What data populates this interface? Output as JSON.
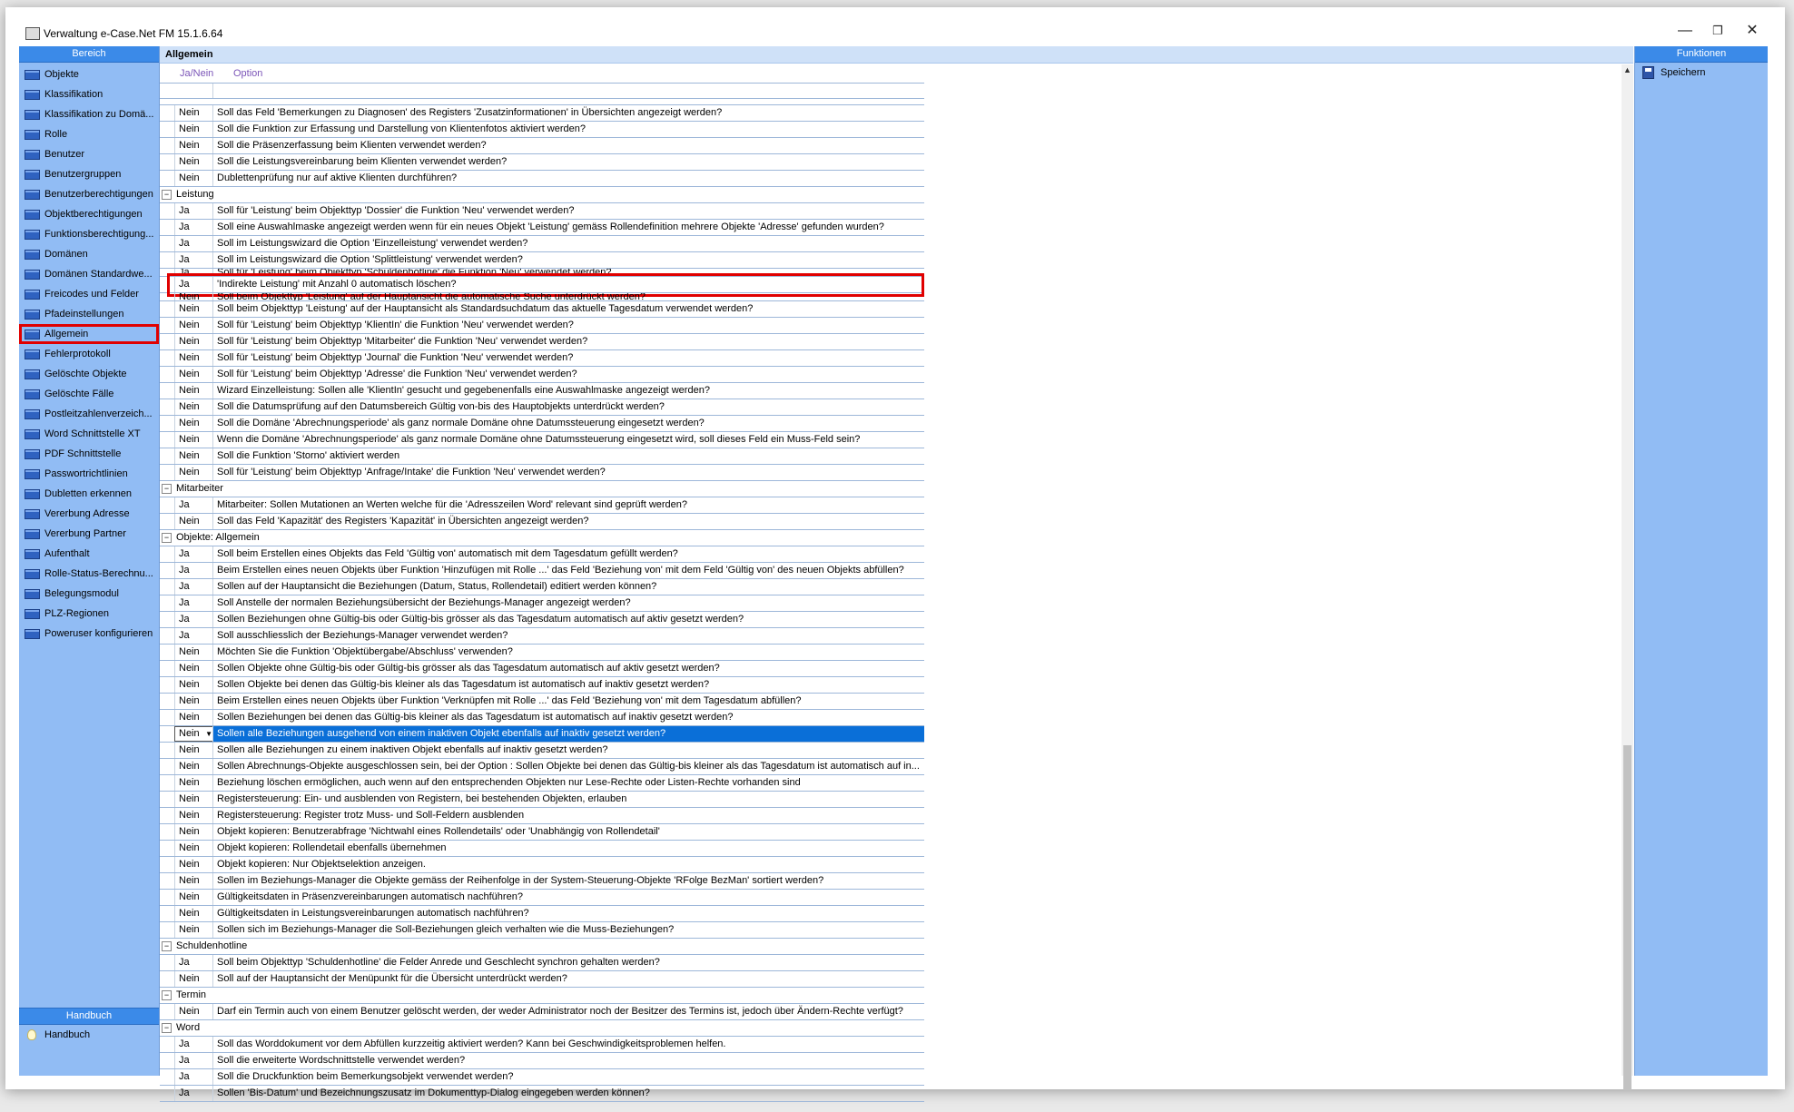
{
  "window": {
    "title": "Verwaltung e-Case.Net FM 15.1.6.64",
    "minimize_glyph": "—",
    "restore_glyph": "❐",
    "close_glyph": "✕"
  },
  "sidebar": {
    "header": "Bereich",
    "items": [
      {
        "label": "Objekte"
      },
      {
        "label": "Klassifikation"
      },
      {
        "label": "Klassifikation zu Domä..."
      },
      {
        "label": "Rolle"
      },
      {
        "label": "Benutzer"
      },
      {
        "label": "Benutzergruppen"
      },
      {
        "label": "Benutzerberechtigungen"
      },
      {
        "label": "Objektberechtigungen"
      },
      {
        "label": "Funktionsberechtigung..."
      },
      {
        "label": "Domänen"
      },
      {
        "label": "Domänen Standardwe..."
      },
      {
        "label": "Freicodes und Felder"
      },
      {
        "label": "Pfadeinstellungen"
      },
      {
        "label": "Allgemein",
        "highlighted": true
      },
      {
        "label": "Fehlerprotokoll"
      },
      {
        "label": "Gelöschte Objekte"
      },
      {
        "label": "Gelöschte Fälle"
      },
      {
        "label": "Postleitzahlenverzeich..."
      },
      {
        "label": "Word Schnittstelle XT"
      },
      {
        "label": "PDF Schnittstelle"
      },
      {
        "label": "Passwortrichtlinien"
      },
      {
        "label": "Dubletten erkennen"
      },
      {
        "label": "Vererbung Adresse"
      },
      {
        "label": "Vererbung Partner"
      },
      {
        "label": "Aufenthalt"
      },
      {
        "label": "Rolle-Status-Berechnu..."
      },
      {
        "label": "Belegungsmodul"
      },
      {
        "label": "PLZ-Regionen"
      },
      {
        "label": "Poweruser konfigurieren"
      }
    ],
    "handbuch_header": "Handbuch",
    "handbuch_item": "Handbuch"
  },
  "main": {
    "header": "Allgemein",
    "col_value": "Ja/Nein",
    "col_option": "Option",
    "rows": [
      {
        "v": "Nein",
        "t": "Soll das Feld 'Bemerkungen zu Diagnosen' des Registers 'Zusatzinformationen' in Übersichten angezeigt werden?"
      },
      {
        "v": "Nein",
        "t": "Soll die Funktion zur Erfassung und Darstellung von Klientenfotos aktiviert werden?"
      },
      {
        "v": "Nein",
        "t": "Soll die Präsenzerfassung beim Klienten verwendet werden?"
      },
      {
        "v": "Nein",
        "t": "Soll die Leistungsvereinbarung beim Klienten verwendet werden?"
      },
      {
        "v": "Nein",
        "t": "Dublettenprüfung nur auf aktive Klienten durchführen?"
      },
      {
        "group": "Leistung",
        "toggle": "−"
      },
      {
        "v": "Ja",
        "t": "Soll für 'Leistung' beim Objekttyp 'Dossier' die Funktion 'Neu' verwendet werden?"
      },
      {
        "v": "Ja",
        "t": "Soll eine Auswahlmaske angezeigt werden wenn für ein neues Objekt 'Leistung' gemäss Rollendefinition mehrere Objekte 'Adresse' gefunden wurden?"
      },
      {
        "v": "Ja",
        "t": "Soll im Leistungswizard die Option 'Einzelleistung' verwendet werden?"
      },
      {
        "v": "Ja",
        "t": "Soll im Leistungswizard die Option 'Splittleistung' verwendet werden?"
      },
      {
        "v": "Ja",
        "t": "Soll für 'Leistung' beim Objekttyp 'Schuldenhotline' die Funktion 'Neu' verwendet werden?",
        "clip": true
      },
      {
        "v": "Ja",
        "t": "'Indirekte Leistung' mit Anzahl 0 automatisch löschen?",
        "boxed": true
      },
      {
        "v": "Nein",
        "t": "Soll beim Objekttyp 'Leistung' auf der Hauptansicht die automatische Suche unterdrückt werden?",
        "clip": true
      },
      {
        "v": "Nein",
        "t": "Soll beim Objekttyp 'Leistung' auf der Hauptansicht als Standardsuchdatum das aktuelle Tagesdatum verwendet werden?"
      },
      {
        "v": "Nein",
        "t": "Soll für 'Leistung' beim Objekttyp 'KlientIn' die Funktion 'Neu' verwendet werden?"
      },
      {
        "v": "Nein",
        "t": "Soll für 'Leistung' beim Objekttyp 'Mitarbeiter' die Funktion 'Neu' verwendet werden?"
      },
      {
        "v": "Nein",
        "t": "Soll für 'Leistung' beim Objekttyp 'Journal' die Funktion 'Neu' verwendet werden?"
      },
      {
        "v": "Nein",
        "t": "Soll für 'Leistung' beim Objekttyp 'Adresse' die Funktion 'Neu' verwendet werden?"
      },
      {
        "v": "Nein",
        "t": "Wizard Einzelleistung: Sollen alle 'KlientIn' gesucht und gegebenenfalls eine Auswahlmaske angezeigt werden?"
      },
      {
        "v": "Nein",
        "t": "Soll die Datumsprüfung auf den Datumsbereich Gültig von-bis des Hauptobjekts unterdrückt werden?"
      },
      {
        "v": "Nein",
        "t": "Soll die Domäne 'Abrechnungsperiode' als ganz normale Domäne ohne Datumssteuerung eingesetzt werden?"
      },
      {
        "v": "Nein",
        "t": "Wenn die Domäne 'Abrechnungsperiode' als ganz normale Domäne ohne Datumssteuerung eingesetzt wird, soll dieses Feld ein Muss-Feld sein?"
      },
      {
        "v": "Nein",
        "t": "Soll die Funktion 'Storno' aktiviert werden"
      },
      {
        "v": "Nein",
        "t": "Soll für 'Leistung' beim Objekttyp 'Anfrage/Intake' die Funktion 'Neu' verwendet werden?"
      },
      {
        "group": "Mitarbeiter",
        "toggle": "−"
      },
      {
        "v": "Ja",
        "t": "Mitarbeiter: Sollen Mutationen an Werten welche für die 'Adresszeilen Word' relevant sind geprüft werden?"
      },
      {
        "v": "Nein",
        "t": "Soll das Feld 'Kapazität' des Registers 'Kapazität' in Übersichten angezeigt werden?"
      },
      {
        "group": "Objekte: Allgemein",
        "toggle": "−"
      },
      {
        "v": "Ja",
        "t": "Soll beim Erstellen eines Objekts das Feld 'Gültig von' automatisch mit dem Tagesdatum gefüllt werden?"
      },
      {
        "v": "Ja",
        "t": "Beim Erstellen eines neuen Objekts über Funktion 'Hinzufügen mit Rolle ...' das Feld 'Beziehung von' mit dem Feld 'Gültig von' des neuen Objekts abfüllen?"
      },
      {
        "v": "Ja",
        "t": "Sollen auf der Hauptansicht die Beziehungen (Datum, Status, Rollendetail) editiert werden können?"
      },
      {
        "v": "Ja",
        "t": "Soll Anstelle der normalen Beziehungsübersicht der Beziehungs-Manager angezeigt werden?"
      },
      {
        "v": "Ja",
        "t": "Sollen Beziehungen ohne Gültig-bis oder Gültig-bis grösser als das Tagesdatum automatisch auf aktiv gesetzt werden?"
      },
      {
        "v": "Ja",
        "t": "Soll ausschliesslich der Beziehungs-Manager verwendet werden?"
      },
      {
        "v": "Nein",
        "t": "Möchten Sie die Funktion 'Objektübergabe/Abschluss' verwenden?"
      },
      {
        "v": "Nein",
        "t": "Sollen Objekte ohne Gültig-bis oder Gültig-bis grösser als das Tagesdatum automatisch auf aktiv gesetzt werden?"
      },
      {
        "v": "Nein",
        "t": "Sollen Objekte bei denen das Gültig-bis kleiner als das Tagesdatum ist automatisch auf inaktiv gesetzt werden?"
      },
      {
        "v": "Nein",
        "t": "Beim Erstellen eines neuen Objekts über Funktion 'Verknüpfen mit Rolle ...' das Feld 'Beziehung von' mit dem Tagesdatum abfüllen?"
      },
      {
        "v": "Nein",
        "t": "Sollen Beziehungen bei denen das Gültig-bis kleiner als das Tagesdatum ist automatisch auf inaktiv gesetzt werden?"
      },
      {
        "v": "Nein",
        "t": "Sollen alle Beziehungen ausgehend von einem inaktiven Objekt ebenfalls auf inaktiv gesetzt werden?",
        "selected": true
      },
      {
        "v": "Nein",
        "t": "Sollen alle Beziehungen zu einem inaktiven Objekt ebenfalls auf inaktiv gesetzt werden?"
      },
      {
        "v": "Nein",
        "t": "Sollen Abrechnungs-Objekte ausgeschlossen sein, bei der Option : Sollen Objekte bei denen das Gültig-bis kleiner als das Tagesdatum ist automatisch auf in..."
      },
      {
        "v": "Nein",
        "t": "Beziehung löschen ermöglichen, auch wenn auf den entsprechenden Objekten nur Lese-Rechte oder Listen-Rechte vorhanden sind"
      },
      {
        "v": "Nein",
        "t": "Registersteuerung: Ein- und ausblenden von Registern, bei bestehenden Objekten, erlauben"
      },
      {
        "v": "Nein",
        "t": "Registersteuerung: Register trotz Muss- und Soll-Feldern ausblenden"
      },
      {
        "v": "Nein",
        "t": "Objekt kopieren: Benutzerabfrage 'Nichtwahl eines Rollendetails' oder 'Unabhängig von Rollendetail'"
      },
      {
        "v": "Nein",
        "t": "Objekt kopieren: Rollendetail ebenfalls übernehmen"
      },
      {
        "v": "Nein",
        "t": "Objekt kopieren: Nur Objektselektion anzeigen."
      },
      {
        "v": "Nein",
        "t": "Sollen im Beziehungs-Manager die Objekte gemäss der Reihenfolge in der System-Steuerung-Objekte 'RFolge BezMan' sortiert werden?"
      },
      {
        "v": "Nein",
        "t": "Gültigkeitsdaten in Präsenzvereinbarungen automatisch nachführen?"
      },
      {
        "v": "Nein",
        "t": "Gültigkeitsdaten in Leistungsvereinbarungen automatisch nachführen?"
      },
      {
        "v": "Nein",
        "t": "Sollen sich im Beziehungs-Manager die Soll-Beziehungen gleich verhalten wie die Muss-Beziehungen?"
      },
      {
        "group": "Schuldenhotline",
        "toggle": "−"
      },
      {
        "v": "Ja",
        "t": "Soll beim Objekttyp 'Schuldenhotline' die Felder Anrede und Geschlecht synchron gehalten werden?"
      },
      {
        "v": "Nein",
        "t": "Soll auf der Hauptansicht der Menüpunkt für die Übersicht unterdrückt werden?"
      },
      {
        "group": "Termin",
        "toggle": "−"
      },
      {
        "v": "Nein",
        "t": "Darf ein Termin auch von einem Benutzer gelöscht werden, der weder Administrator noch der Besitzer des Termins ist, jedoch über Ändern-Rechte verfügt?"
      },
      {
        "group": "Word",
        "toggle": "−"
      },
      {
        "v": "Ja",
        "t": "Soll das Worddokument vor dem Abfüllen kurzzeitig aktiviert werden? Kann bei Geschwindigkeitsproblemen helfen."
      },
      {
        "v": "Ja",
        "t": "Soll die erweiterte Wordschnittstelle verwendet werden?"
      },
      {
        "v": "Ja",
        "t": "Soll die Druckfunktion beim Bemerkungsobjekt verwendet werden?"
      },
      {
        "v": "Ja",
        "t": "Sollen 'Bis-Datum' und Bezeichnungszusatz im Dokumenttyp-Dialog eingegeben werden können?"
      }
    ],
    "scroll_up_glyph": "▲",
    "dropdown_glyph": "▼"
  },
  "functions": {
    "header": "Funktionen",
    "items": [
      {
        "label": "Speichern"
      }
    ]
  },
  "colors": {
    "panel_bg": "#91bcf4",
    "panel_header": "#3b8ae8",
    "selection": "#0a6fd8",
    "highlight_box": "#e00000",
    "column_header_text": "#7b55b8"
  }
}
